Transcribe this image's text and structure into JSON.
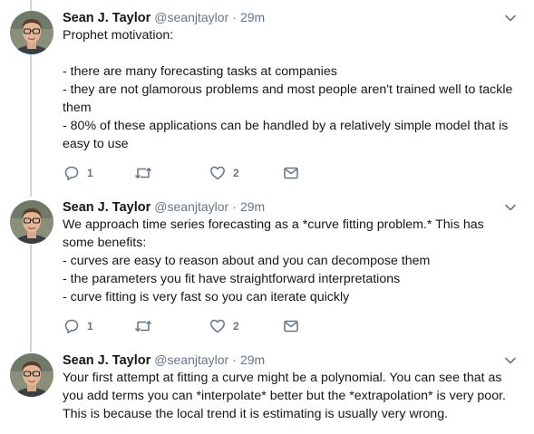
{
  "tweets": [
    {
      "author_name": "Sean J. Taylor",
      "handle": "@seanjtaylor",
      "separator": "·",
      "time": "29m",
      "text": "Prophet motivation:\n\n- there are many forecasting tasks at companies\n- they are not glamorous problems and most people aren't trained well to tackle them\n- 80% of these applications can be handled by a relatively simple model that is easy to use",
      "reply_count": "1",
      "like_count": "2"
    },
    {
      "author_name": "Sean J. Taylor",
      "handle": "@seanjtaylor",
      "separator": "·",
      "time": "29m",
      "text": "We approach time series forecasting as a *curve fitting problem.* This has some benefits:\n- curves are easy to reason about and you can decompose them\n- the parameters you fit have straightforward interpretations\n- curve fitting is very fast so you can iterate quickly",
      "reply_count": "1",
      "like_count": "2"
    },
    {
      "author_name": "Sean J. Taylor",
      "handle": "@seanjtaylor",
      "separator": "·",
      "time": "29m",
      "text": "Your first attempt at fitting a curve might be a polynomial. You can see that as you add terms you can *interpolate* better but the *extrapolation* is very poor. This is because the local trend it is estimating is usually very wrong."
    }
  ],
  "colors": {
    "text": "#14171a",
    "secondary": "#657786",
    "thread_line": "#ccd6dd"
  },
  "icons": [
    "avatar",
    "chevron-down-icon",
    "reply-icon",
    "retweet-icon",
    "like-icon",
    "direct-message-icon"
  ]
}
